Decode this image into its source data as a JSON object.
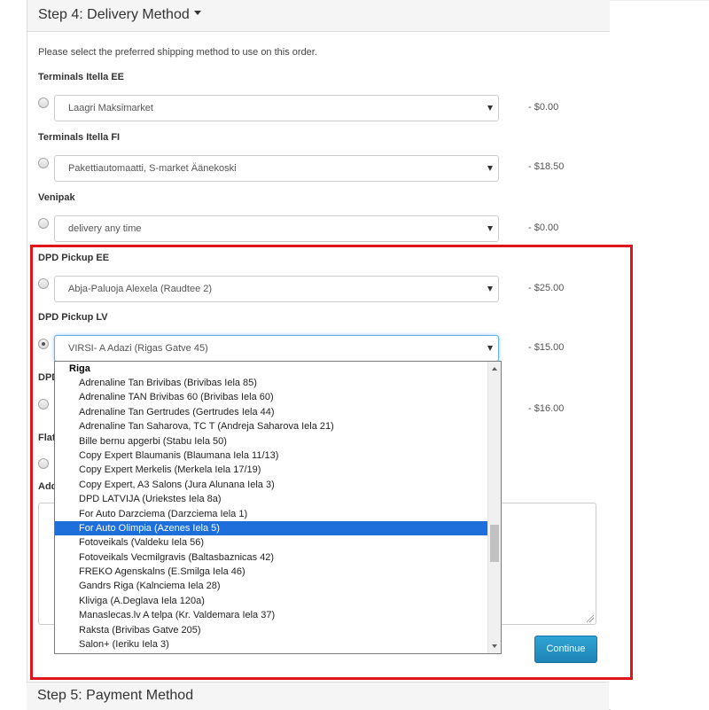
{
  "step4": {
    "title": "Step 4: Delivery Method"
  },
  "intro": "Please select the preferred shipping method to use on this order.",
  "methods": [
    {
      "group": "Terminals Itella EE",
      "selected": "Laagri Maksimarket",
      "price": "- $0.00",
      "checked": false
    },
    {
      "group": "Terminals Itella FI",
      "selected": "Pakettiautomaatti, S-market Äänekoski",
      "price": "- $18.50",
      "checked": false
    },
    {
      "group": "Venipak",
      "selected": "delivery any time",
      "price": "- $0.00",
      "checked": false
    },
    {
      "group": "DPD Pickup EE",
      "selected": "Abja-Paluoja Alexela (Raudtee 2)",
      "price": "- $25.00",
      "checked": false
    },
    {
      "group": "DPD Pickup LV",
      "selected": "VIRSI- A Adazi (Rigas Gatve 45)",
      "price": "- $15.00",
      "checked": true
    }
  ],
  "hidden_rows": {
    "dpd_partial": "DPD",
    "dpd_price": "- $16.00",
    "flat_partial": "Flat",
    "add_partial": "Add"
  },
  "dropdown": {
    "group": "Riga",
    "items": [
      "Adrenaline Tan Brivibas (Brivibas Iela 85)",
      "Adrenaline TAN Brivibas 60 (Brivibas Iela 60)",
      "Adrenaline Tan Gertrudes (Gertrudes Iela 44)",
      "Adrenaline Tan Saharova, TC T (Andreja Saharova Iela 21)",
      "Bille bernu apgerbi (Stabu Iela 50)",
      "Copy Expert Blaumanis (Blaumana Iela 11/13)",
      "Copy Expert Merkelis (Merkela Iela 17/19)",
      "Copy Expert, A3 Salons (Jura Alunana Iela 3)",
      "DPD LATVIJA (Uriekstes Iela 8a)",
      "For Auto Darzciema (Darzciema Iela 1)",
      "For Auto Olimpia (Azenes Iela 5)",
      "Fotoveikals (Valdeku Iela 56)",
      "Fotoveikals Vecmilgravis (Baltasbaznicas 42)",
      "FREKO Agenskalns (E.Smilga Iela 46)",
      "Gandrs Riga (Kalnciema Iela 28)",
      "Kliviga (A.Deglava Iela 120a)",
      "Manaslecas.lv A telpa (Kr. Valdemara Iela 37)",
      "Raksta (Brivibas Gatve 205)",
      "Salon+ (Ieriku Iela 3)"
    ],
    "highlighted_item": "For Auto Olimpia (Azenes Iela 5)"
  },
  "continue_label": "Continue",
  "step5": {
    "title": "Step 5: Payment Method"
  },
  "colors": {
    "highlight_border": "#e0141c",
    "selected_option": "#1e6fdc",
    "continue_button": "#2496c8"
  }
}
